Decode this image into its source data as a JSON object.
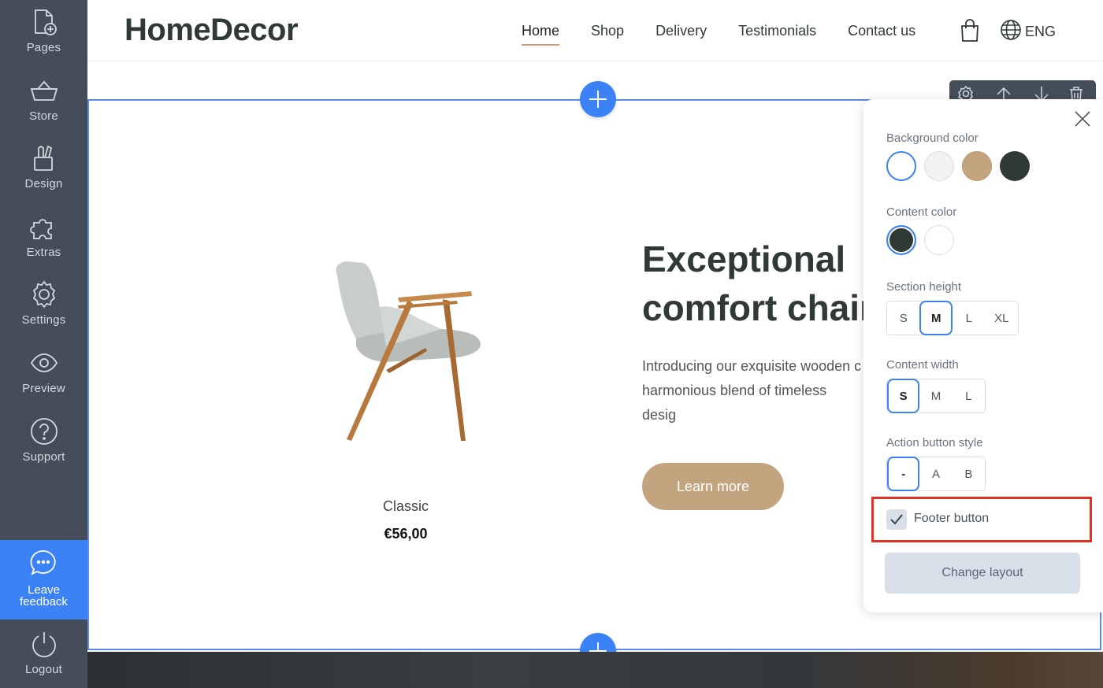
{
  "sidebar": {
    "items": [
      {
        "label": "Pages",
        "icon": "pages-add-icon"
      },
      {
        "label": "Store",
        "icon": "basket-icon"
      },
      {
        "label": "Design",
        "icon": "design-tools-icon"
      },
      {
        "label": "Extras",
        "icon": "puzzle-icon"
      },
      {
        "label": "Settings",
        "icon": "gear-icon"
      },
      {
        "label": "Preview",
        "icon": "eye-icon"
      },
      {
        "label": "Support",
        "icon": "question-icon"
      }
    ],
    "feedback_label": "Leave feedback",
    "logout_label": "Logout"
  },
  "header": {
    "logo": "HomeDecor",
    "nav": [
      "Home",
      "Shop",
      "Delivery",
      "Testimonials",
      "Contact us"
    ],
    "active_nav": "Home",
    "language": "ENG"
  },
  "section": {
    "product_name": "Classic",
    "product_price": "€56,00",
    "heading_line1": "Exceptional",
    "heading_line2": "comfort chair",
    "description": "Introducing our exquisite wooden c\nharmonious blend of timeless desig\nunparalleled craftsmanship.",
    "button_label": "Learn more"
  },
  "panel": {
    "background_label": "Background color",
    "background_colors": [
      "#ffffff",
      "#f2f2f2",
      "#c2a57e",
      "#2f3a34"
    ],
    "background_selected": 0,
    "content_label": "Content color",
    "content_colors": [
      "#2f3a34",
      "#ffffff"
    ],
    "content_selected": 0,
    "height_label": "Section height",
    "height_options": [
      "S",
      "M",
      "L",
      "XL"
    ],
    "height_selected": "M",
    "width_label": "Content width",
    "width_options": [
      "S",
      "M",
      "L"
    ],
    "width_selected": "S",
    "action_label": "Action button style",
    "action_options": [
      "-",
      "A",
      "B"
    ],
    "action_selected": "-",
    "footer_button_label": "Footer button",
    "footer_button_checked": true,
    "change_layout_label": "Change layout"
  },
  "colors": {
    "sidebar": "#454d59",
    "accent": "#3b82f6",
    "brand_tan": "#c2a57e",
    "highlight": "#e53026"
  }
}
